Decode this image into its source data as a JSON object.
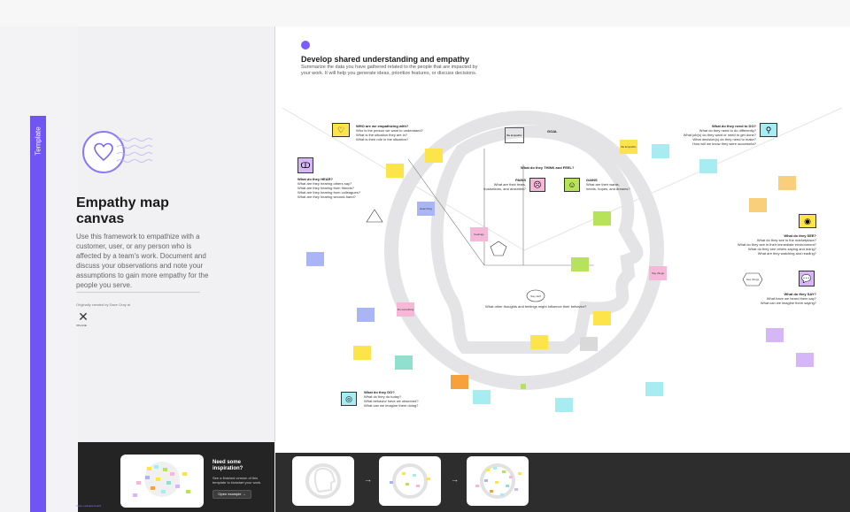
{
  "sidebar_tab": {
    "label": "Template"
  },
  "left_panel": {
    "title_line1": "Empathy map",
    "title_line2": "canvas",
    "description": "Use this framework to empathize with a customer, user, or any person who is affected by a team's work. Document and discuss your observations and note your assumptions to gain more empathy for the people you serve.",
    "credit": "Originally created by Dave Gray at",
    "credit_logo_text": "XPLANE"
  },
  "inspiration": {
    "title": "Need some inspiration?",
    "description": "See a finished version of this template to kickstart your work.",
    "button_label": "Open example",
    "bottom_badge": "Open example board"
  },
  "canvas_header": {
    "title": "Develop shared understanding and empathy",
    "description": "Summarize the data you have gathered related to the people that are impacted by your work. It will help you generate ideas, prioritize features, or discuss decisions."
  },
  "sections": {
    "who": {
      "title": "WHO are we empathizing with?",
      "lines": [
        "Who is the person we want to understand?",
        "What is the situation they are in?",
        "What is their role in the situation?"
      ]
    },
    "goal": {
      "title": "GOAL",
      "icon_text": "Be Empathic"
    },
    "do_need": {
      "title": "What do they need to DO?",
      "lines": [
        "What do they need to do differently?",
        "What job(s) do they want or need to get done?",
        "What decision(s) do they need to make?",
        "How will we know they were successful?"
      ]
    },
    "hear": {
      "title": "What do they HEAR?",
      "lines": [
        "What are they hearing others say?",
        "What are they hearing from friends?",
        "What are they hearing from colleagues?",
        "What are they hearing second-hand?"
      ]
    },
    "think_feel": {
      "title": "What do they THINK and FEEL?"
    },
    "pains": {
      "title": "PAINS",
      "lines": [
        "What are their fears,",
        "frustrations, and anxieties?"
      ]
    },
    "gains": {
      "title": "GAINS",
      "lines": [
        "What are their wants,",
        "needs, hopes, and dreams?"
      ]
    },
    "see": {
      "title": "What do they SEE?",
      "lines": [
        "What do they see in the marketplace?",
        "What do they see in their immediate environment?",
        "What do they see others saying and doing?",
        "What are they watching and reading?"
      ]
    },
    "say": {
      "title": "What do they SAY?",
      "lines": [
        "What have we heard them say?",
        "What can we imagine them saying?"
      ]
    },
    "other": {
      "title": "What other thoughts and feelings might influence their behavior?"
    },
    "do": {
      "title": "What do they DO?",
      "lines": [
        "What do they do today?",
        "What behavior have we observed?",
        "What can we imagine them doing?"
      ]
    }
  },
  "tiny_labels": {
    "be_empathic": "Be Empathic",
    "say_thing": "Say things",
    "do_something": "Do something",
    "feelings": "Feelings",
    "say_bubble": "Say stuff",
    "hear_thing": "Hear thing",
    "see_thing": "See things",
    "not_possible": "Not possible"
  },
  "colors": {
    "accent": "#7055f2",
    "yellow": "#fde44b",
    "lime": "#b7e35a",
    "cyan": "#a7ecf0",
    "blue": "#a9b5f5",
    "pink": "#f6b8d8",
    "orange": "#f7a13d",
    "teal": "#8fe0cf",
    "violet": "#d5b6f7",
    "sand": "#f9cf7b"
  }
}
